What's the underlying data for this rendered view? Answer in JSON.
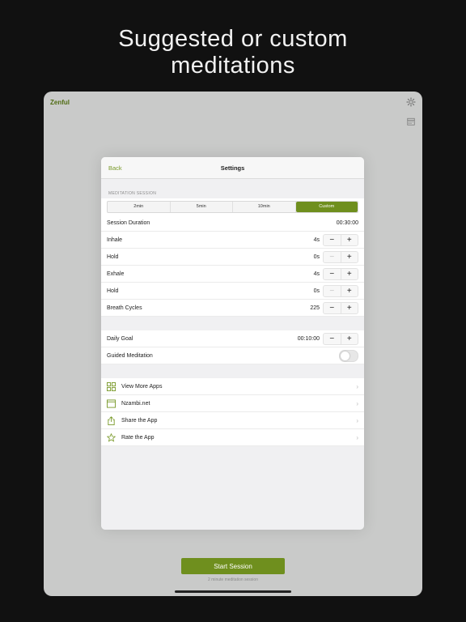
{
  "headline": {
    "line1": "Suggested or custom",
    "line2": "meditations"
  },
  "app": {
    "title": "Zenful",
    "settings_icon": "gear-icon",
    "calendar_icon": "calendar-icon"
  },
  "settings": {
    "back_label": "Back",
    "title": "Settings",
    "section_header": "MEDITATION SESSION",
    "segments": [
      "2min",
      "5min",
      "10min",
      "Custom"
    ],
    "selected_segment": "Custom",
    "session_duration_label": "Session Duration",
    "session_duration_value": "00:30:00",
    "inhale": {
      "label": "Inhale",
      "value": "4s"
    },
    "hold1": {
      "label": "Hold",
      "value": "0s"
    },
    "exhale": {
      "label": "Exhale",
      "value": "4s"
    },
    "hold2": {
      "label": "Hold",
      "value": "0s"
    },
    "breath_cycles": {
      "label": "Breath Cycles",
      "value": "225"
    },
    "daily_goal": {
      "label": "Daily Goal",
      "value": "00:10:00"
    },
    "guided": {
      "label": "Guided Meditation",
      "on": false
    },
    "links": {
      "more_apps": "View More Apps",
      "website": "Nzambi.net",
      "share": "Share the App",
      "rate": "Rate the App"
    },
    "stepper_minus": "−",
    "stepper_plus": "+"
  },
  "footer": {
    "start_label": "Start Session",
    "subtitle": "2 minute meditation session"
  },
  "colors": {
    "accent": "#6f8f1e",
    "background": "#111111",
    "device_bg": "#c9cac9"
  }
}
